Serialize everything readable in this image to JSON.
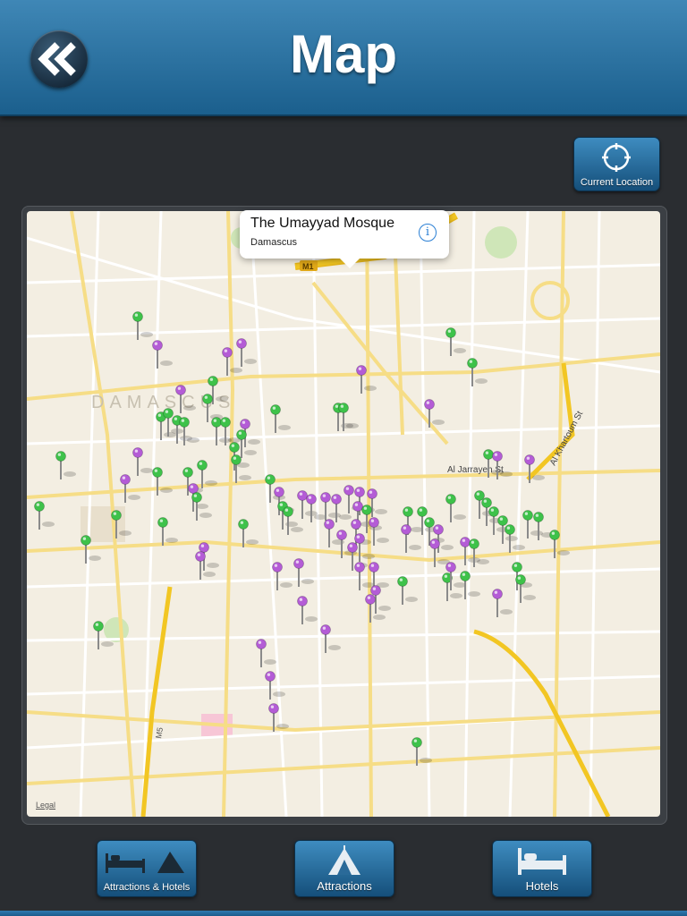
{
  "header": {
    "title": "Map",
    "back_icon": "double-chevron-left-icon"
  },
  "toolbar": {
    "current_location_label": "Current Location",
    "current_location_icon": "crosshair-icon"
  },
  "map": {
    "legal_label": "Legal",
    "city_label": "DAMASCUS",
    "road_labels": [
      "M1",
      "M5",
      "Al Khartoum St",
      "Al Jarrayeh St"
    ],
    "callout": {
      "title": "The Umayyad Mosque",
      "subtitle": "Damascus",
      "info_icon": "info-icon"
    },
    "pin_colors": {
      "attractions": "#b45cd6",
      "hotels": "#3ec24a"
    }
  },
  "tabs": [
    {
      "label": "Attractions & Hotels",
      "icon": "bed-and-tent-icon"
    },
    {
      "label": "Attractions",
      "icon": "tent-icon"
    },
    {
      "label": "Hotels",
      "icon": "bed-icon"
    }
  ],
  "colors": {
    "header_top": "#3f87b6",
    "header_bottom": "#1b5f8d",
    "background": "#2a2d31",
    "map_bg": "#f3eee2",
    "major_road": "#f2c623"
  }
}
